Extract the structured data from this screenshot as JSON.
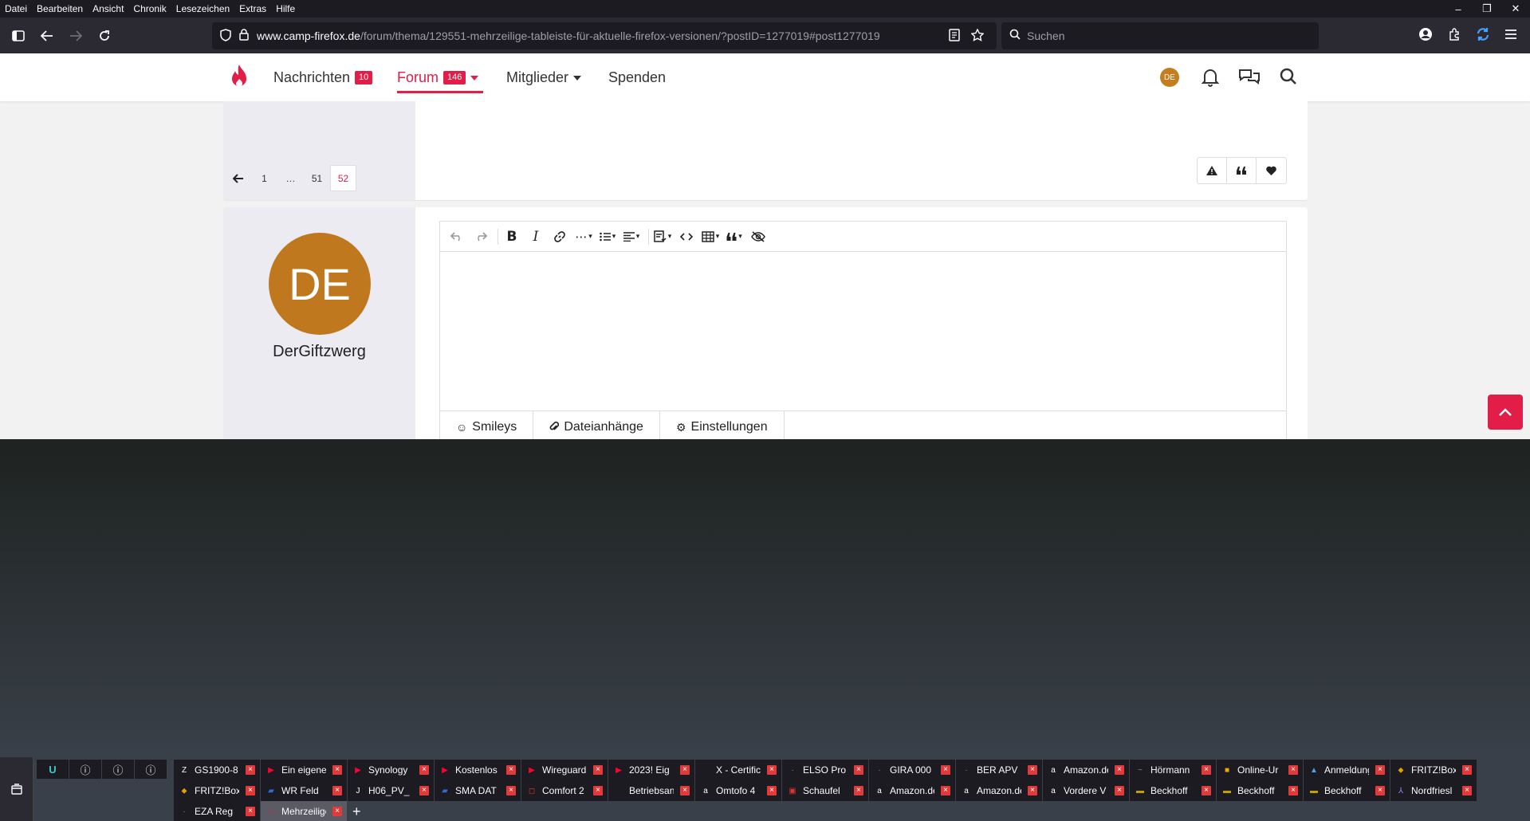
{
  "menubar": {
    "items": [
      "Datei",
      "Bearbeiten",
      "Ansicht",
      "Chronik",
      "Lesezeichen",
      "Extras",
      "Hilfe"
    ]
  },
  "window_controls": {
    "minimize": "–",
    "restore": "❐",
    "close": "✕"
  },
  "navbar": {
    "url_host": "www.camp-firefox.de",
    "url_path": "/forum/thema/129551-mehrzeilige-tableiste-für-aktuelle-firefox-versionen/?postID=1277019#post1277019",
    "search_placeholder": "Suchen"
  },
  "site": {
    "nav": [
      {
        "label": "Nachrichten",
        "badge": "10"
      },
      {
        "label": "Forum",
        "badge": "146",
        "active": true
      },
      {
        "label": "Mitglieder"
      },
      {
        "label": "Spenden"
      }
    ],
    "user_initials": "DE",
    "accent_color": "#e11d48"
  },
  "pagination": {
    "items": [
      "1",
      "…",
      "51",
      "52"
    ],
    "current": "52"
  },
  "post": {
    "avatar_initials": "DE",
    "username": "DerGiftzwerg",
    "avatar_color": "#c0781f"
  },
  "editor": {
    "tabs": [
      "Smileys",
      "Dateianhänge",
      "Einstellungen"
    ]
  },
  "tabs": {
    "row1": [
      "GS1900-8",
      "Ein eigener",
      "Synology",
      "Kostenlos",
      "Wireguard",
      "2023! Eig",
      "X - Certificate",
      "ELSO Pro",
      "GIRA 000",
      "BER APV",
      "Amazon.de",
      "Hörmann",
      "Online-Ur",
      "Anmeldung",
      "FRITZ!Box"
    ],
    "row2": [
      "FRITZ!Box",
      "WR Feld",
      "H06_PV_",
      "SMA DAT",
      "Comfort 2",
      "Betriebsanleitung",
      "Omtofo 4",
      "Schaufel",
      "Amazon.de",
      "Amazon.de",
      "Vordere V",
      "Beckhoff",
      "Beckhoff",
      "Beckhoff",
      "Nordfriesl"
    ],
    "row3": [
      "EZA Reg",
      "Mehrzeilige"
    ]
  }
}
